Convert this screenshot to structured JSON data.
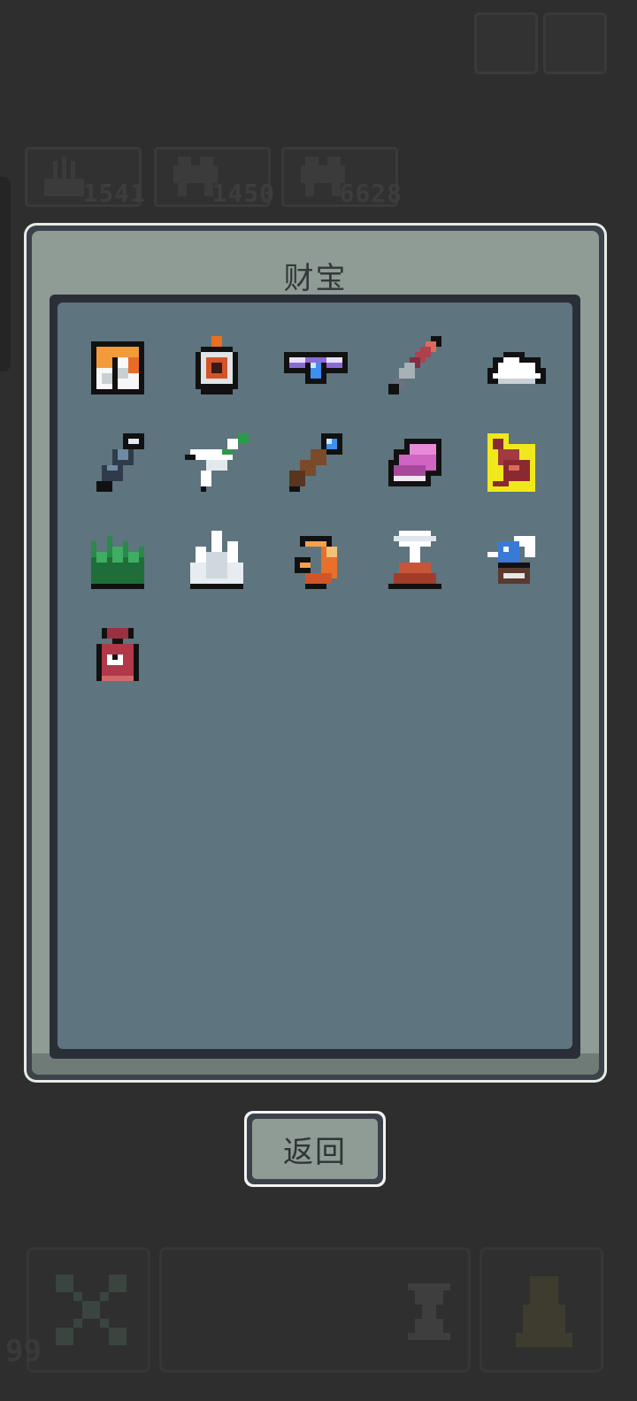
{
  "background": {
    "resources": [
      {
        "icon": "hand-icon",
        "count": "1541"
      },
      {
        "icon": "monster-icon",
        "count": "1450"
      },
      {
        "icon": "monster-icon",
        "count": "6628"
      }
    ],
    "bottom_bar": {
      "left_count": "99",
      "left_icon": "crossed-swords-icon",
      "middle_icon": "hourglass-icon",
      "right_icon": "character-icon"
    }
  },
  "dialog": {
    "title": "财宝",
    "items": [
      {
        "icon": "banner-icon"
      },
      {
        "icon": "red-eye-orb-icon"
      },
      {
        "icon": "blue-gem-crown-icon"
      },
      {
        "icon": "sword-icon"
      },
      {
        "icon": "cloud-icon"
      },
      {
        "icon": "telescope-icon"
      },
      {
        "icon": "paper-plane-icon"
      },
      {
        "icon": "magic-staff-icon"
      },
      {
        "icon": "pink-book-icon"
      },
      {
        "icon": "red-bird-icon",
        "highlighted": true
      },
      {
        "icon": "green-grass-icon"
      },
      {
        "icon": "white-crystal-icon"
      },
      {
        "icon": "orange-crescent-icon"
      },
      {
        "icon": "volcano-icon"
      },
      {
        "icon": "blue-creature-icon"
      },
      {
        "icon": "red-pouch-icon"
      }
    ]
  },
  "back_button": {
    "label": "返回"
  },
  "colors": {
    "background": "#2e2e2e",
    "dialog_body": "#8f9c95",
    "grid_area": "#5e747e",
    "frame_dark": "#3c424a",
    "highlight": "#f0e81a"
  }
}
